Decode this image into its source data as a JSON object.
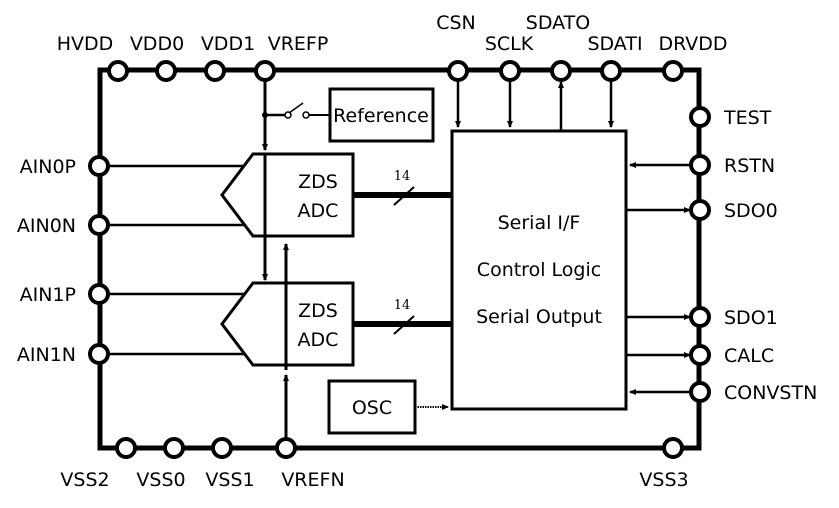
{
  "diagram": {
    "colors": {
      "stroke": "#000000",
      "background": "#ffffff"
    },
    "pins": {
      "top": [
        "HVDD",
        "VDD0",
        "VDD1",
        "VREFP",
        "CSN",
        "SCLK",
        "SDATO",
        "SDATI",
        "DRVDD"
      ],
      "left": [
        "AIN0P",
        "AIN0N",
        "AIN1P",
        "AIN1N"
      ],
      "right": [
        "TEST",
        "RSTN",
        "SDO0",
        "SDO1",
        "CALC",
        "CONVSTN"
      ],
      "bottom": [
        "VSS2",
        "VSS0",
        "VSS1",
        "VREFN",
        "VSS3"
      ]
    },
    "blocks": {
      "reference": "Reference",
      "adc0": {
        "line1": "ZDS",
        "line2": "ADC"
      },
      "adc1": {
        "line1": "ZDS",
        "line2": "ADC"
      },
      "logic": {
        "line1": "Serial I/F",
        "line2": "Control Logic",
        "line3": "Serial Output"
      },
      "osc": "OSC"
    },
    "bus_width": {
      "adc0": "14",
      "adc1": "14"
    }
  }
}
